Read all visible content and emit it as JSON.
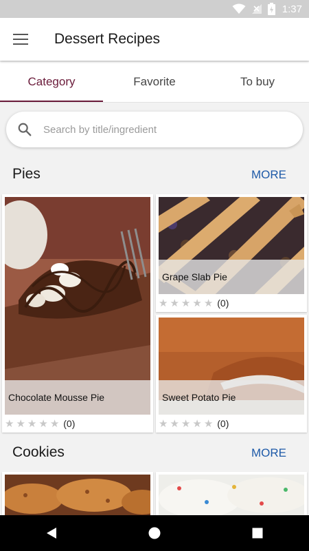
{
  "status": {
    "time": "1:37"
  },
  "app": {
    "title": "Dessert Recipes"
  },
  "tabs": [
    {
      "label": "Category",
      "active": true
    },
    {
      "label": "Favorite",
      "active": false
    },
    {
      "label": "To buy",
      "active": false
    }
  ],
  "search": {
    "placeholder": "Search by title/ingredient",
    "value": ""
  },
  "sections": [
    {
      "title": "Pies",
      "more_label": "MORE",
      "items": [
        {
          "title": "Chocolate Mousse Pie",
          "rating": 0,
          "count": "(0)"
        },
        {
          "title": "Grape Slab Pie",
          "rating": 0,
          "count": "(0)"
        },
        {
          "title": "Sweet Potato Pie",
          "rating": 0,
          "count": "(0)"
        }
      ]
    },
    {
      "title": "Cookies",
      "more_label": "MORE",
      "items": []
    }
  ],
  "colors": {
    "accent": "#6a1b3a",
    "link": "#1e5aa8"
  },
  "icons": {
    "menu": "hamburger-menu-icon",
    "search": "search-icon",
    "wifi": "wifi-icon",
    "signal": "signal-icon",
    "battery": "battery-icon",
    "back": "back-icon",
    "home": "home-icon",
    "recents": "recents-icon"
  }
}
